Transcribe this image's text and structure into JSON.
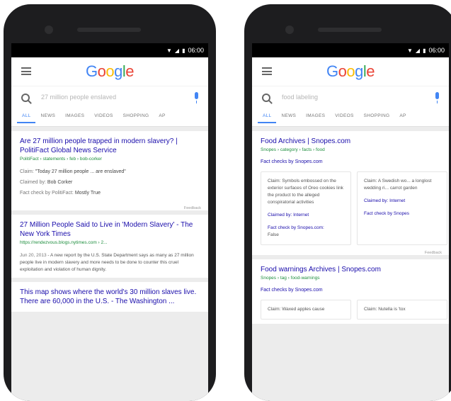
{
  "status": {
    "time": "06:00"
  },
  "logo": [
    "G",
    "o",
    "o",
    "g",
    "l",
    "e"
  ],
  "tabs": [
    "ALL",
    "NEWS",
    "IMAGES",
    "VIDEOS",
    "SHOPPING",
    "AP"
  ],
  "left": {
    "query": "27 million people enslaved",
    "result1": {
      "title": "Are 27 million people trapped in modern slavery? | PolitiFact Global News Service",
      "url": "PolitiFact › statements › feb › bob-corker",
      "claim_label": "Claim:",
      "claim": "\"Today 27 million people ... are enslaved\"",
      "claimed_label": "Claimed by:",
      "claimed": "Bob Corker",
      "factcheck_label": "Fact check by PolitiFact:",
      "factcheck": "Mostly True",
      "feedback": "Feedback"
    },
    "result2": {
      "title": "27 Million People Said to Live in 'Modern Slavery' - The New York Times",
      "url": "https://rendezvous.blogs.nytimes.com › 2...",
      "date": "Jun 20, 2013",
      "snippet": "- A new report by the U.S. State Department says as many as 27 million people live in modern slavery and more needs to be done to counter this cruel exploitation and violation of human dignity."
    },
    "result3": {
      "title": "This map shows where the world's 30 million slaves live. There are 60,000 in the U.S. - The Washington ..."
    }
  },
  "right": {
    "query": "food labeling",
    "result1": {
      "title": "Food Archives | Snopes.com",
      "url": "Snopes › category › facts › food",
      "factlink": "Fact checks by Snopes.com",
      "card1": {
        "claim": "Claim: Symbols embossed on the exterior surfaces of Oreo cookies link the product to the alleged conspiratorial activities",
        "claimed": "Claimed by: Internet",
        "factcheck": "Fact check by Snopes.com:",
        "verdict": "False"
      },
      "card2": {
        "claim": "Claim: A Swedish wo... a longlost wedding ri... carrot garden",
        "claimed": "Claimed by: Internet",
        "factcheck": "Fact check by Snopes"
      },
      "feedback": "Feedback"
    },
    "result2": {
      "title": "Food warnings Archives | Snopes.com",
      "url": "Snopes › tag › food-warnings",
      "factlink": "Fact checks by Snopes.com",
      "card1": {
        "claim": "Claim: Waxed apples cause"
      },
      "card2": {
        "claim": "Claim: Nutella is 'tox"
      }
    }
  }
}
